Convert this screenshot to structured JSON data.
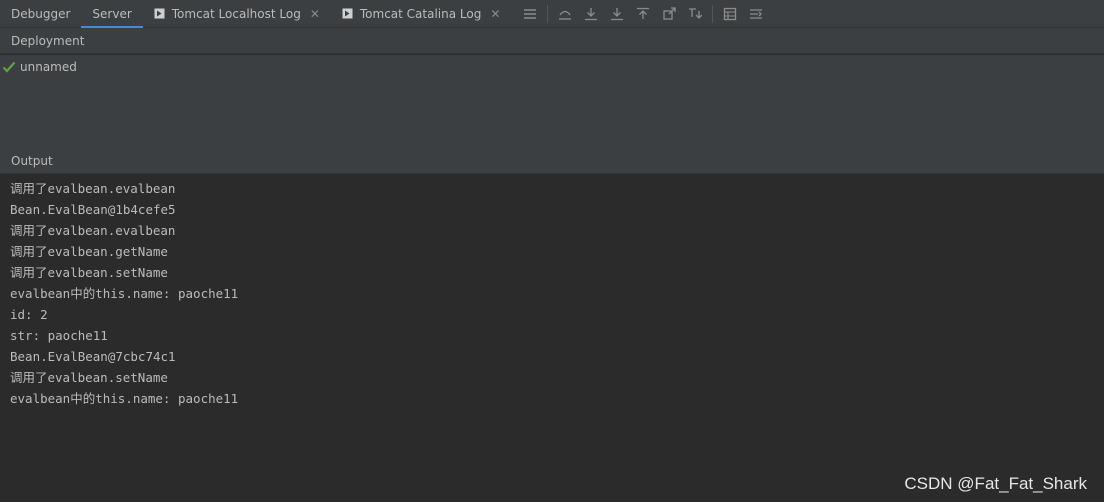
{
  "tabs": [
    {
      "label": "Debugger",
      "active": false,
      "icon": null,
      "closable": false
    },
    {
      "label": "Server",
      "active": true,
      "icon": null,
      "closable": false
    },
    {
      "label": "Tomcat Localhost Log",
      "active": false,
      "icon": "console-play-icon",
      "closable": true
    },
    {
      "label": "Tomcat Catalina Log",
      "active": false,
      "icon": "console-play-icon",
      "closable": true
    }
  ],
  "toolbar_icons": [
    "menu-icon",
    "scroll-to-end-icon",
    "download-icon",
    "download-alt-icon",
    "upload-icon",
    "export-icon",
    "filter-down-icon",
    "layout-grid-icon",
    "settings-list-icon"
  ],
  "deployment": {
    "header": "Deployment",
    "items": [
      {
        "label": "unnamed",
        "status": "ok"
      }
    ]
  },
  "output": {
    "header": "Output",
    "lines": [
      "调用了evalbean.evalbean",
      "Bean.EvalBean@1b4cefe5",
      "调用了evalbean.evalbean",
      "调用了evalbean.getName",
      "调用了evalbean.setName",
      "evalbean中的this.name: paoche11",
      "id: 2",
      "str: paoche11",
      "Bean.EvalBean@7cbc74c1",
      "调用了evalbean.setName",
      "evalbean中的this.name: paoche11"
    ]
  },
  "watermark": "CSDN @Fat_Fat_Shark",
  "colors": {
    "panel": "#3c3f41",
    "console": "#2b2b2b",
    "accent": "#4a88c7",
    "ok": "#5fa04e",
    "text": "#bbbbbb"
  }
}
